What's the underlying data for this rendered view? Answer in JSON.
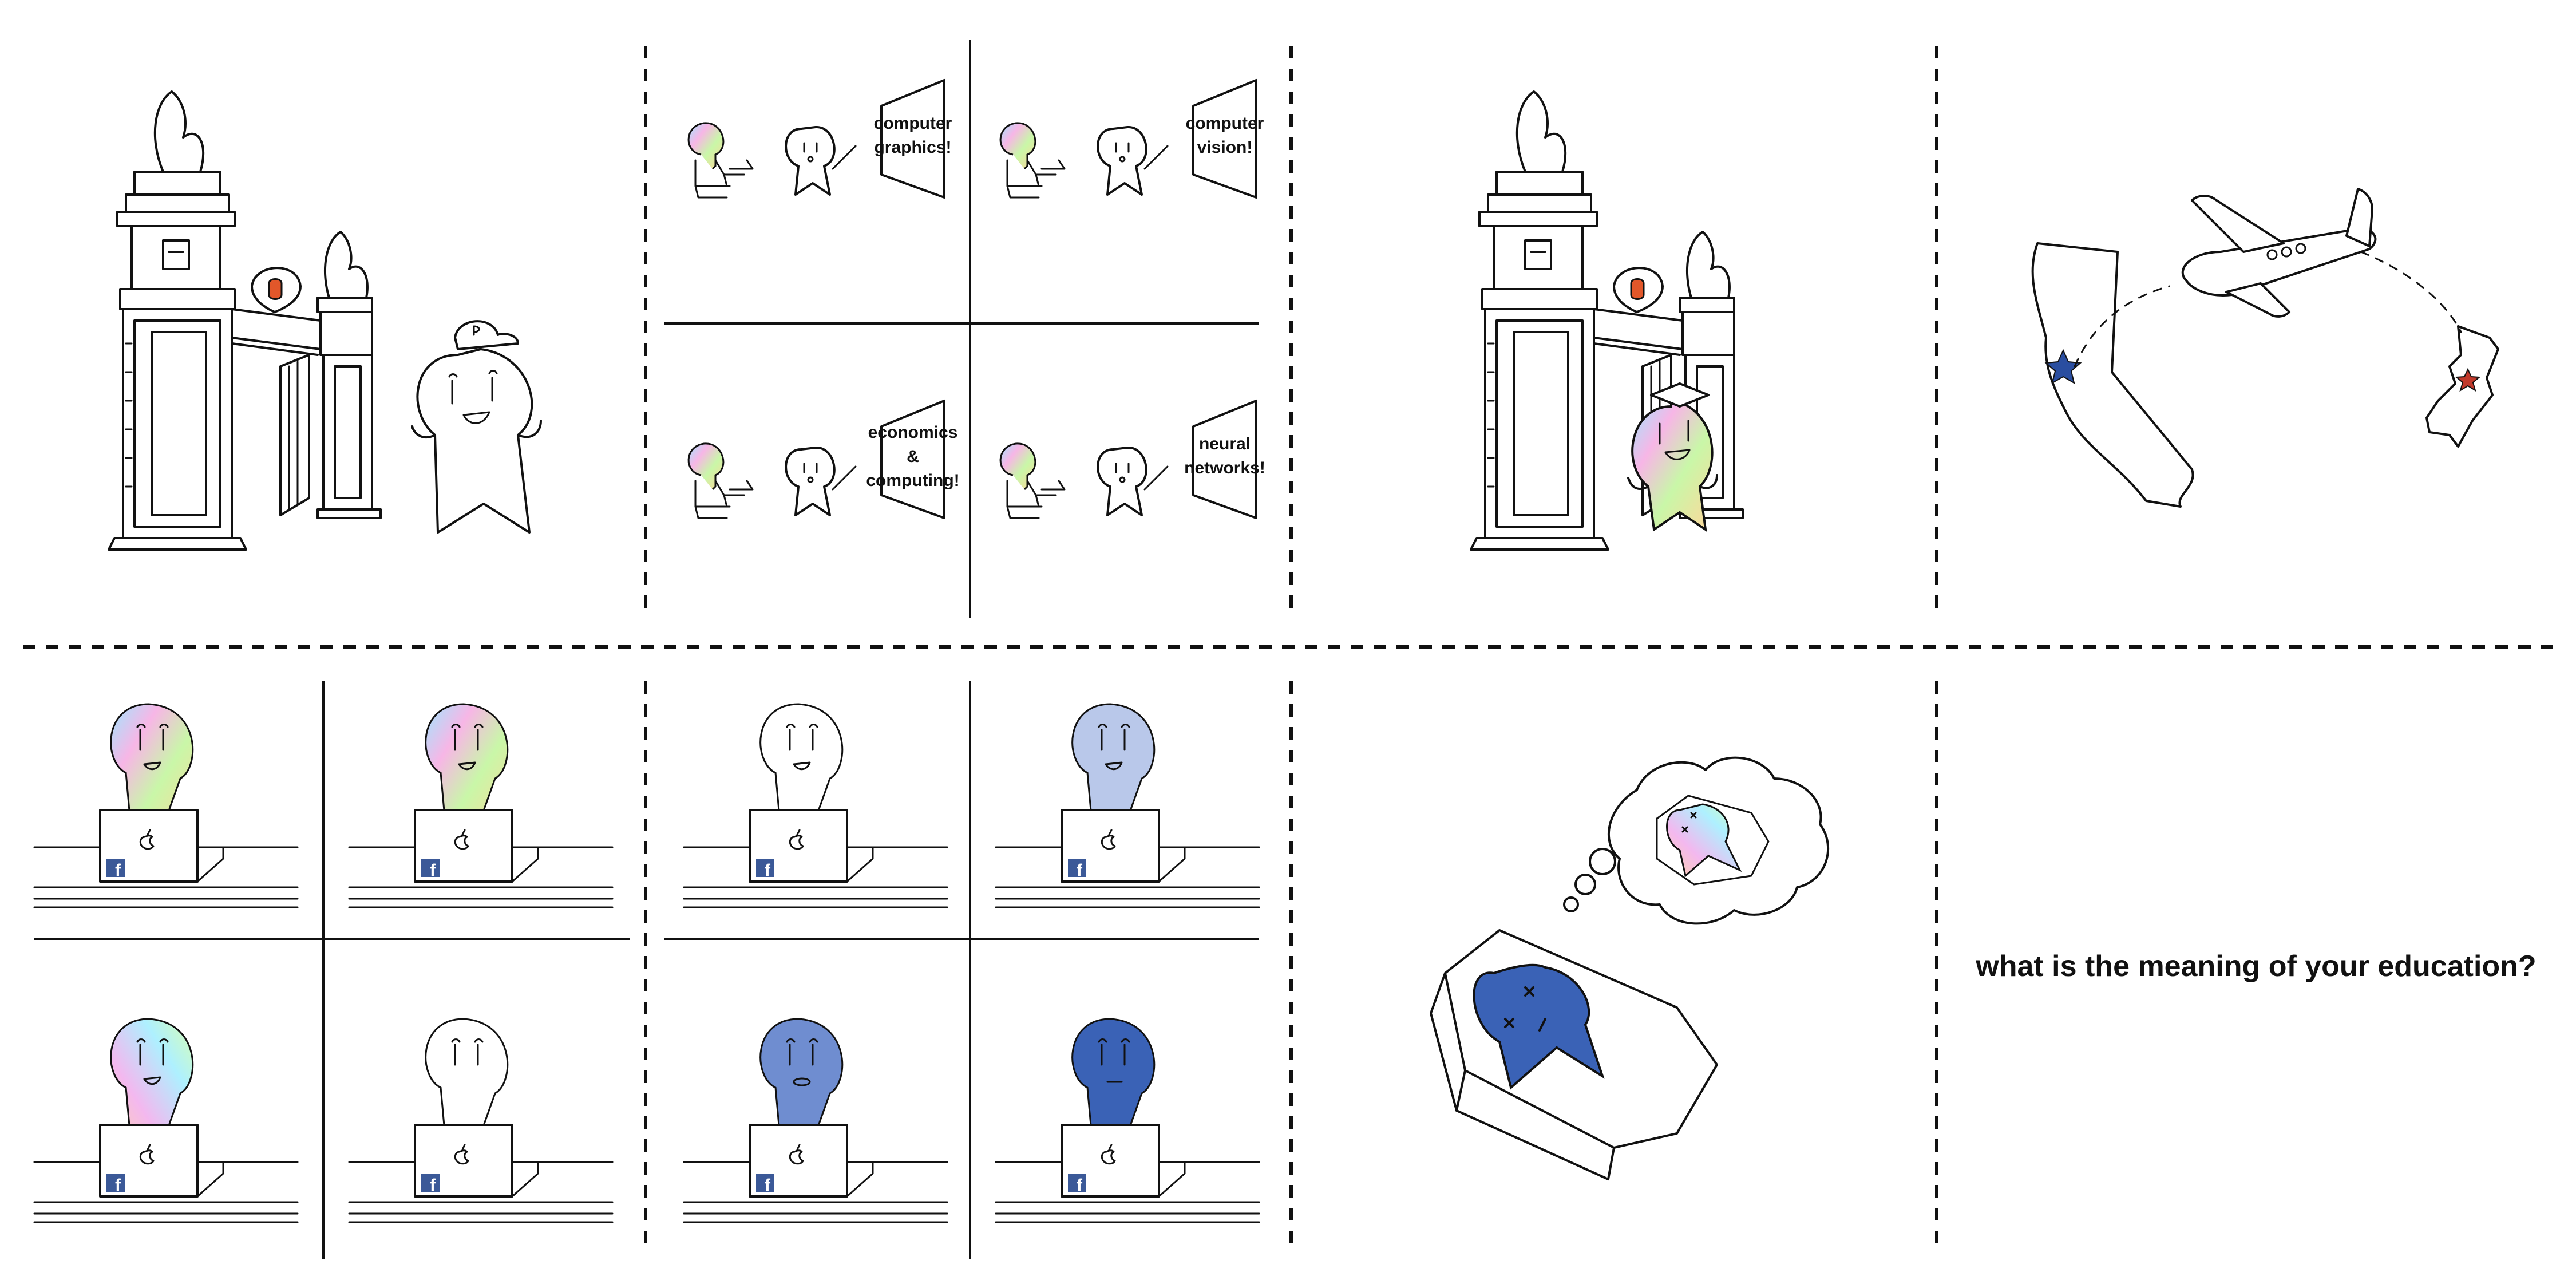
{
  "comic": {
    "row1": {
      "panel2_labels": [
        [
          "computer",
          "graphics!"
        ],
        [
          "computer",
          "vision!"
        ],
        [
          "economics",
          "&",
          "computing!"
        ],
        [
          "neural",
          "networks!"
        ]
      ]
    },
    "row2": {
      "caption": "what is the meaning of your education?",
      "laptop_brand_icon": "facebook-icon",
      "laptop_logo_icon": "apple-icon"
    }
  },
  "colors": {
    "ink": "#111111",
    "blue_dark": "#3a62b6",
    "blue_mid": "#6f8dd0",
    "blue_light": "#b9c8ea",
    "facebook": "#3b5998",
    "star_blue": "#2a4ea0",
    "star_red": "#c0392b"
  }
}
